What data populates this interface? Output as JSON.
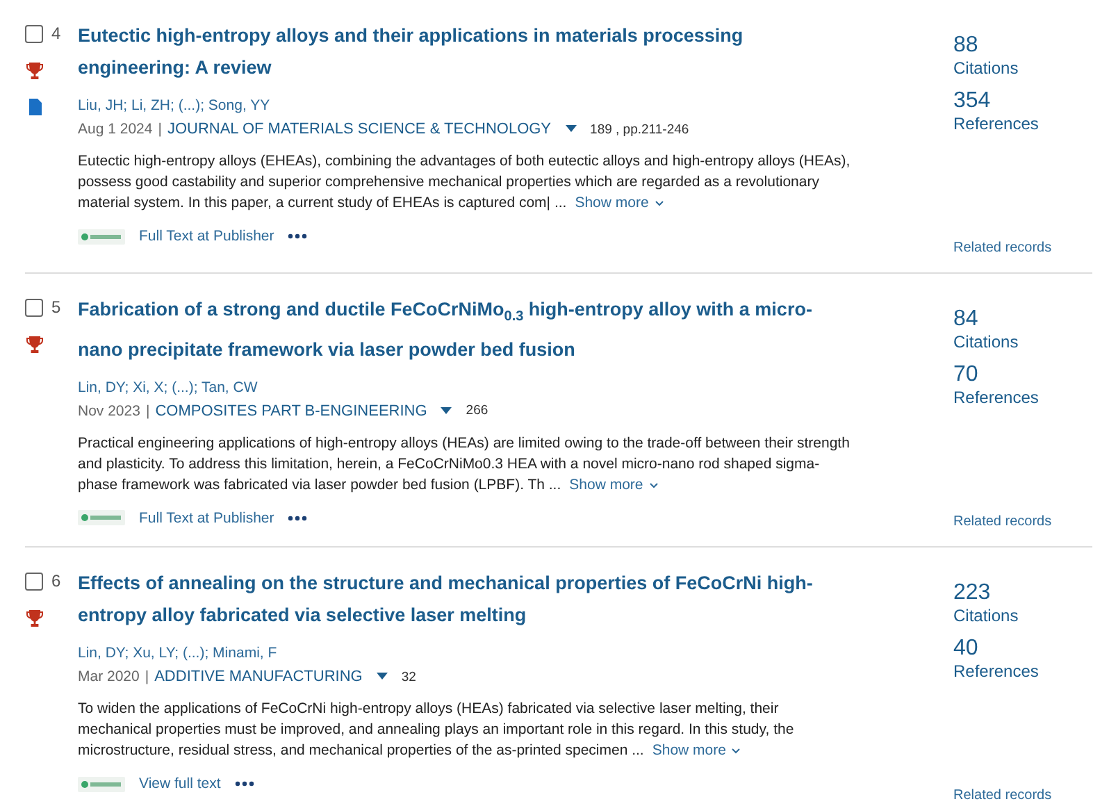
{
  "records": [
    {
      "number": "4",
      "checked": false,
      "title": "Eutectic high-entropy alloys and their applications in materials processing engineering: A review",
      "markers": [
        {
          "kind": "trophy"
        },
        {
          "kind": "document"
        }
      ],
      "authors": "Liu, JH; Li, ZH; (...); Song, YY",
      "date": "Aug 1 2024",
      "separator": "|",
      "journal": "JOURNAL OF MATERIALS SCIENCE & TECHNOLOGY",
      "volume": "189 , pp.211-246",
      "abstract": "Eutectic high-entropy alloys (EHEAs), combining the advantages of both eutectic alloys and high-entropy alloys (HEAs), possess good castability and superior comprehensive mechanical properties which are regarded as a revolutionary material system. In this paper, a current study of EHEAs is captured com| ...",
      "show_more": "Show more",
      "link": "Full Text at Publisher",
      "citations": "88",
      "citations_label": "Citations",
      "references": "354",
      "references_label": "References",
      "related": "Related records"
    },
    {
      "number": "5",
      "checked": false,
      "title": "Fabrication of a strong and ductile FeCoCrNiMo$_{0.3}$ high-entropy alloy with a micro-nano precipitate framework via laser powder bed fusion",
      "markers": [
        {
          "kind": "trophy"
        }
      ],
      "authors": "Lin, DY; Xi, X; (...); Tan, CW",
      "date": "Nov 2023",
      "separator": "|",
      "journal": "COMPOSITES PART B-ENGINEERING",
      "volume": "266",
      "abstract": "Practical engineering applications of high-entropy alloys (HEAs) are limited owing to the trade-off between their strength and plasticity. To address this limitation, herein, a FeCoCrNiMo0.3 HEA with a novel micro-nano rod shaped sigma-phase framework was fabricated via laser powder bed fusion (LPBF). Th ...",
      "show_more": "Show more",
      "link": "Full Text at Publisher",
      "citations": "84",
      "citations_label": "Citations",
      "references": "70",
      "references_label": "References",
      "related": "Related records"
    },
    {
      "number": "6",
      "checked": false,
      "title": "Effects of annealing on the structure and mechanical properties of FeCoCrNi high-entropy alloy fabricated via selective laser melting",
      "markers": [
        {
          "kind": "trophy"
        }
      ],
      "authors": "Lin, DY; Xu, LY; (...); Minami, F",
      "date": "Mar 2020",
      "separator": "|",
      "journal": "ADDITIVE MANUFACTURING",
      "volume": "32",
      "abstract": "To widen the applications of FeCoCrNi high-entropy alloys (HEAs) fabricated via selective laser melting, their mechanical properties must be improved, and annealing plays an important role in this regard. In this study, the microstructure, residual stress, and mechanical properties of the as-printed specimen ...",
      "show_more": "Show more",
      "link": "View full text",
      "citations": "223",
      "citations_label": "Citations",
      "references": "40",
      "references_label": "References",
      "related": "Related records"
    }
  ]
}
